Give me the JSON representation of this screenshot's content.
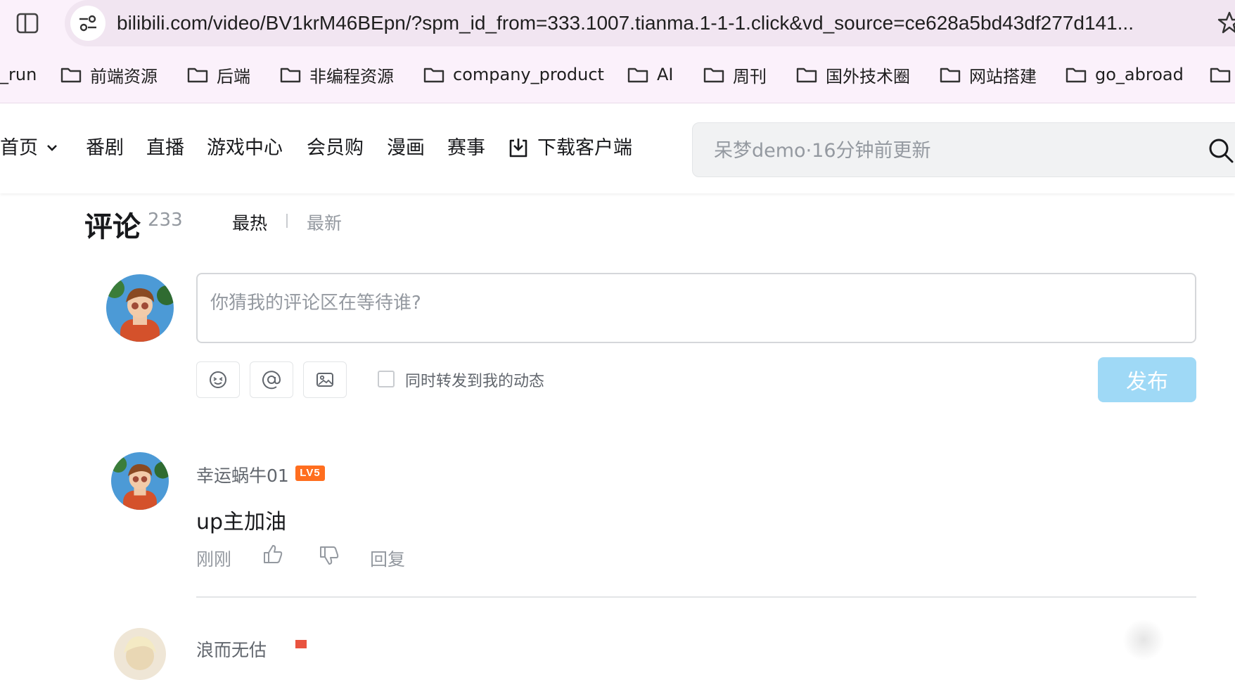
{
  "browser": {
    "url": "bilibili.com/video/BV1krM46BEpn/?spm_id_from=333.1007.tianma.1-1-1.click&vd_source=ce628a5bd43df277d141...",
    "bookmarks": {
      "first": "_run",
      "items": [
        "前端资源",
        "后端",
        "非编程资源",
        "company_product",
        "AI",
        "周刊",
        "国外技术圈",
        "网站搭建",
        "go_abroad"
      ]
    }
  },
  "header": {
    "nav": {
      "home": "首页",
      "items": [
        "番剧",
        "直播",
        "游戏中心",
        "会员购",
        "漫画",
        "赛事"
      ],
      "download": "下载客户端"
    },
    "search": {
      "placeholder": "呆梦demo·16分钟前更新"
    }
  },
  "comments": {
    "title": "评论",
    "count": "233",
    "sort_hot": "最热",
    "sort_new": "最新",
    "input_placeholder": "你猜我的评论区在等待谁?",
    "forward_label": "同时转发到我的动态",
    "publish": "发布",
    "list": [
      {
        "user": "幸运蜗牛01",
        "level": "LV5",
        "content": "up主加油",
        "time": "刚刚",
        "reply_label": "回复"
      }
    ],
    "next_user_partial": "浪而无估"
  },
  "colors": {
    "chrome_bg": "#fbf1fb",
    "url_pill": "#f1e5f1",
    "publish_disabled": "#9fd9f6",
    "level_badge": "#ff6e1f",
    "muted_text": "#9499a0"
  },
  "icons": [
    "sidebar-toggle-icon",
    "site-info-icon",
    "star-icon",
    "folder-icon",
    "chevron-down-icon",
    "download-icon",
    "search-icon",
    "emoji-icon",
    "at-icon",
    "image-icon",
    "like-icon",
    "dislike-icon"
  ]
}
